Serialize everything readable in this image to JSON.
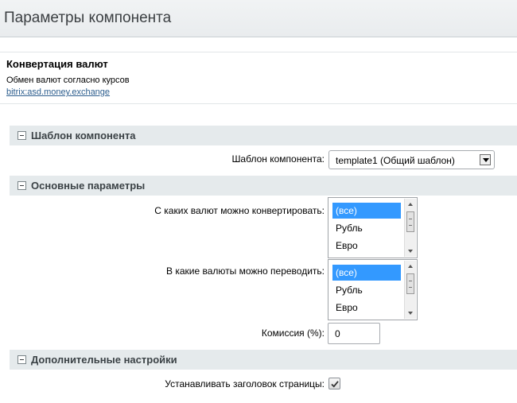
{
  "window": {
    "title": "Параметры компонента"
  },
  "component": {
    "name": "Конвертация валют",
    "description": "Обмен валют согласно курсов",
    "code": "bitrix:asd.money.exchange"
  },
  "sections": [
    {
      "label": "Шаблон компонента",
      "fields": [
        {
          "label": "Шаблон компонента:",
          "type": "select",
          "value": "template1 (Общий шаблон)"
        }
      ]
    },
    {
      "label": "Основные параметры",
      "fields": [
        {
          "label": "С каких валют можно конвертировать:",
          "type": "multiselect",
          "options": [
            "(все)",
            "Рубль",
            "Евро"
          ],
          "selected": "(все)"
        },
        {
          "label": "В какие валюты можно переводить:",
          "type": "multiselect",
          "options": [
            "(все)",
            "Рубль",
            "Евро"
          ],
          "selected": "(все)"
        },
        {
          "label": "Комиссия (%):",
          "type": "text",
          "value": "0"
        }
      ]
    },
    {
      "label": "Дополнительные настройки",
      "fields": [
        {
          "label": "Устанавливать заголовок страницы:",
          "type": "checkbox",
          "checked": true
        }
      ]
    }
  ],
  "icons": {
    "section_toggle": "collapse-minus-icon",
    "select_arrow": "dropdown-arrow-icon",
    "checkbox_mark": "checkmark-icon"
  }
}
